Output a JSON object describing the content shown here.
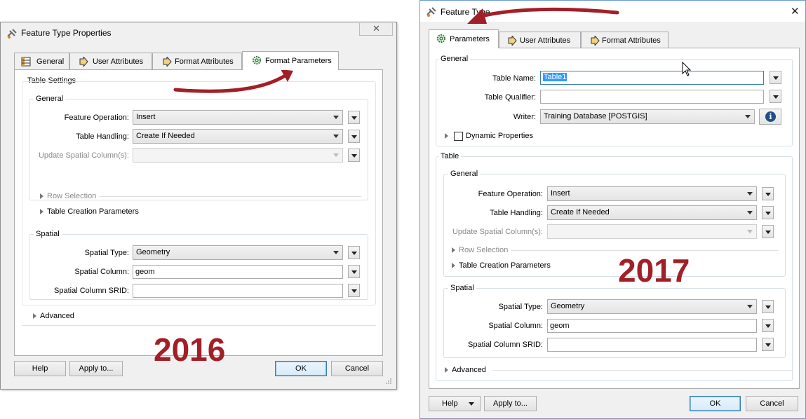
{
  "dialog_2016": {
    "title": "Feature Type Properties",
    "tabs": [
      {
        "label": "General"
      },
      {
        "label": "User Attributes"
      },
      {
        "label": "Format Attributes"
      },
      {
        "label": "Format Parameters"
      }
    ],
    "table_settings": {
      "title": "Table Settings",
      "general": {
        "title": "General",
        "feature_operation": {
          "label": "Feature Operation:",
          "value": "Insert"
        },
        "table_handling": {
          "label": "Table Handling:",
          "value": "Create If Needed"
        },
        "update_spatial": {
          "label": "Update Spatial Column(s):",
          "value": ""
        },
        "row_selection": "Row Selection",
        "table_creation": "Table Creation Parameters"
      },
      "spatial": {
        "title": "Spatial",
        "spatial_type": {
          "label": "Spatial Type:",
          "value": "Geometry"
        },
        "spatial_column": {
          "label": "Spatial Column:",
          "value": "geom"
        },
        "spatial_srid": {
          "label": "Spatial Column SRID:",
          "value": ""
        }
      },
      "advanced": "Advanced"
    },
    "year": "2016",
    "buttons": {
      "help": "Help",
      "apply": "Apply to...",
      "ok": "OK",
      "cancel": "Cancel"
    }
  },
  "dialog_2017": {
    "title": "Feature Type",
    "tabs": [
      {
        "label": "Parameters"
      },
      {
        "label": "User Attributes"
      },
      {
        "label": "Format Attributes"
      }
    ],
    "general": {
      "title": "General",
      "table_name": {
        "label": "Table Name:",
        "value": "Table1"
      },
      "table_qualifier": {
        "label": "Table Qualifier:",
        "value": ""
      },
      "writer": {
        "label": "Writer:",
        "value": "Training Database [POSTGIS]"
      },
      "dynamic_properties": "Dynamic Properties"
    },
    "table": {
      "title": "Table",
      "general": {
        "title": "General",
        "feature_operation": {
          "label": "Feature Operation:",
          "value": "Insert"
        },
        "table_handling": {
          "label": "Table Handling:",
          "value": "Create If Needed"
        },
        "update_spatial": {
          "label": "Update Spatial Column(s):",
          "value": ""
        },
        "row_selection": "Row Selection",
        "table_creation": "Table Creation Parameters"
      },
      "spatial": {
        "title": "Spatial",
        "spatial_type": {
          "label": "Spatial Type:",
          "value": "Geometry"
        },
        "spatial_column": {
          "label": "Spatial Column:",
          "value": "geom"
        },
        "spatial_srid": {
          "label": "Spatial Column SRID:",
          "value": ""
        }
      }
    },
    "advanced": "Advanced",
    "year": "2017",
    "buttons": {
      "help": "Help",
      "apply": "Apply to...",
      "ok": "OK",
      "cancel": "Cancel"
    }
  },
  "colors": {
    "annotation_red": "#a31f27",
    "selection_blue": "#3399ff",
    "info_blue": "#1f4f86"
  }
}
